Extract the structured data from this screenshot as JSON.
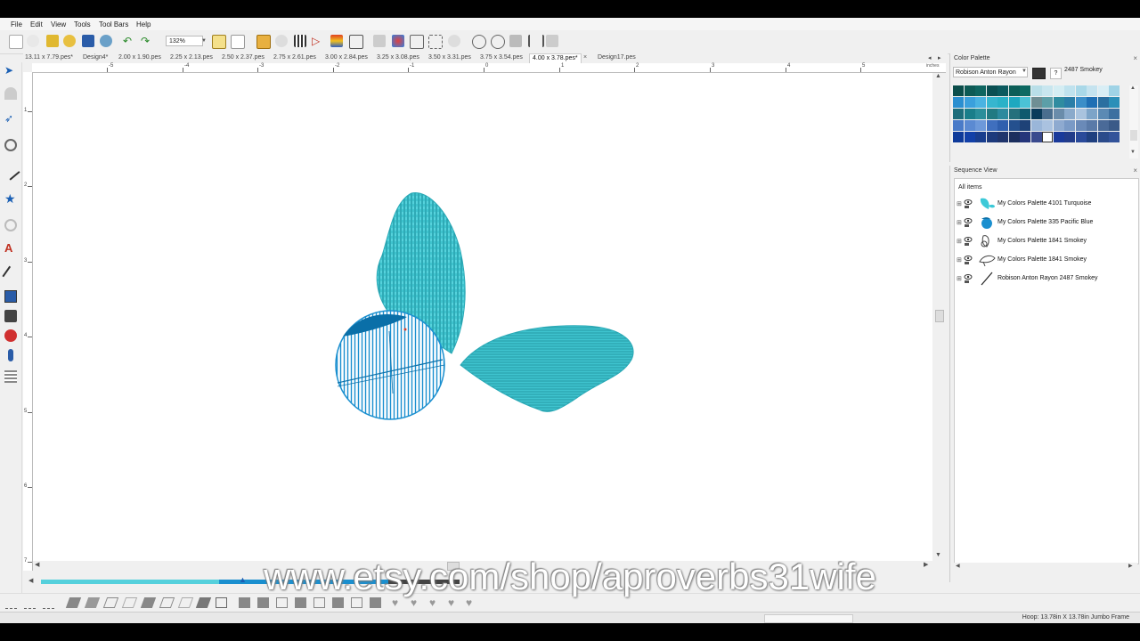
{
  "menu": [
    "File",
    "Edit",
    "View",
    "Tools",
    "Tool Bars",
    "Help"
  ],
  "toolbar": {
    "zoom": "132%"
  },
  "tabs": [
    {
      "label": "13.11 x 7.79.pes*"
    },
    {
      "label": "Design4*"
    },
    {
      "label": "2.00 x 1.90.pes"
    },
    {
      "label": "2.25 x 2.13.pes"
    },
    {
      "label": "2.50 x 2.37.pes"
    },
    {
      "label": "2.75 x 2.61.pes"
    },
    {
      "label": "3.00 x 2.84.pes"
    },
    {
      "label": "3.25 x 3.08.pes"
    },
    {
      "label": "3.50 x 3.31.pes"
    },
    {
      "label": "3.75 x 3.54.pes"
    },
    {
      "label": "4.00 x 3.78.pes*",
      "active": true
    },
    {
      "label": "Design17.pes"
    }
  ],
  "tab_close": "×",
  "ruler": {
    "unit": "inches",
    "h_numbers": [
      "-5",
      "-4",
      "-3",
      "-2",
      "-1",
      "0",
      "1",
      "2",
      "3",
      "4",
      "5"
    ],
    "v_numbers": [
      "1",
      "2",
      "3",
      "4",
      "5",
      "6",
      "7"
    ]
  },
  "color_palette": {
    "title": "Color Palette",
    "selected_palette": "Robison Anton Rayon",
    "help": "?",
    "current_color": "2487 Smokey"
  },
  "sequence_view": {
    "title": "Sequence View",
    "root": "All items",
    "items": [
      {
        "label": "My Colors Palette 4101 Turquoise",
        "color": "#3cc9d8"
      },
      {
        "label": "My Colors Palette 335 Pacific Blue",
        "color": "#1a8fcf"
      },
      {
        "label": "My Colors Palette 1841 Smokey",
        "color": "#444444"
      },
      {
        "label": "My Colors Palette 1841 Smokey",
        "color": "#444444"
      },
      {
        "label": "Robison Anton Rayon 2487 Smokey",
        "color": "#222222"
      }
    ]
  },
  "panel_close": "×",
  "status": {
    "hoop": "Hoop: 13.78in X 13.78in Jumbo Frame"
  },
  "watermark": "www.etsy.com/shop/aproverbs31wife",
  "colors": {
    "wing": "#3fc4cf",
    "circle": "#2aa2d5",
    "dark": "#0a6fa8",
    "accent": "#1e7fb4"
  }
}
